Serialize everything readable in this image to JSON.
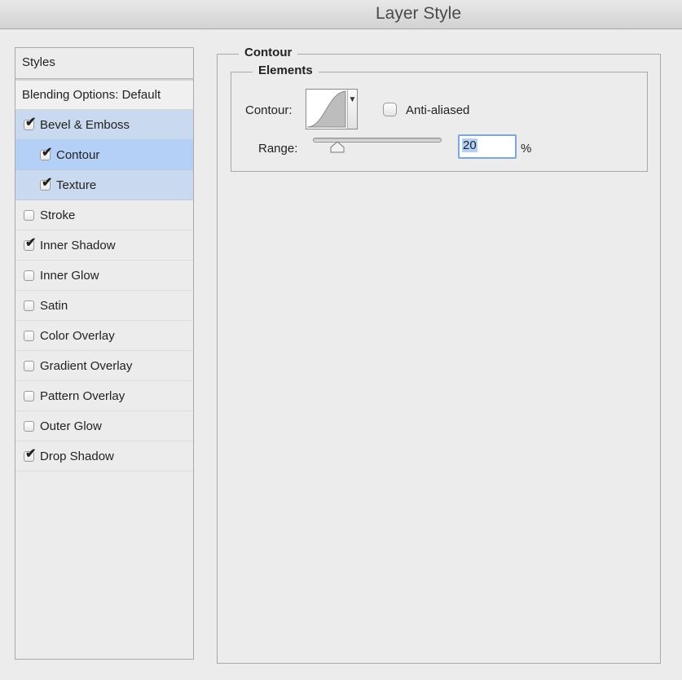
{
  "window": {
    "title": "Layer Style"
  },
  "sidebar": {
    "header": "Styles",
    "blending": "Blending Options: Default",
    "items": [
      {
        "label": "Bevel & Emboss",
        "checked": true
      },
      {
        "label": "Contour",
        "checked": true
      },
      {
        "label": "Texture",
        "checked": true
      },
      {
        "label": "Stroke",
        "checked": false
      },
      {
        "label": "Inner Shadow",
        "checked": true
      },
      {
        "label": "Inner Glow",
        "checked": false
      },
      {
        "label": "Satin",
        "checked": false
      },
      {
        "label": "Color Overlay",
        "checked": false
      },
      {
        "label": "Gradient Overlay",
        "checked": false
      },
      {
        "label": "Pattern Overlay",
        "checked": false
      },
      {
        "label": "Outer Glow",
        "checked": false
      },
      {
        "label": "Drop Shadow",
        "checked": true
      }
    ]
  },
  "panel": {
    "title": "Contour",
    "group_title": "Elements",
    "contour_label": "Contour:",
    "anti_aliased_label": "Anti-aliased",
    "anti_aliased": false,
    "range_label": "Range:",
    "range_value": "20",
    "range_unit": "%"
  },
  "check_glyph": "✔",
  "dropdown_glyph": "▼",
  "colors": {
    "selected_row": "#c9d9ef",
    "current_row": "#b4d0f7",
    "focus_ring": "#7da7dc"
  }
}
